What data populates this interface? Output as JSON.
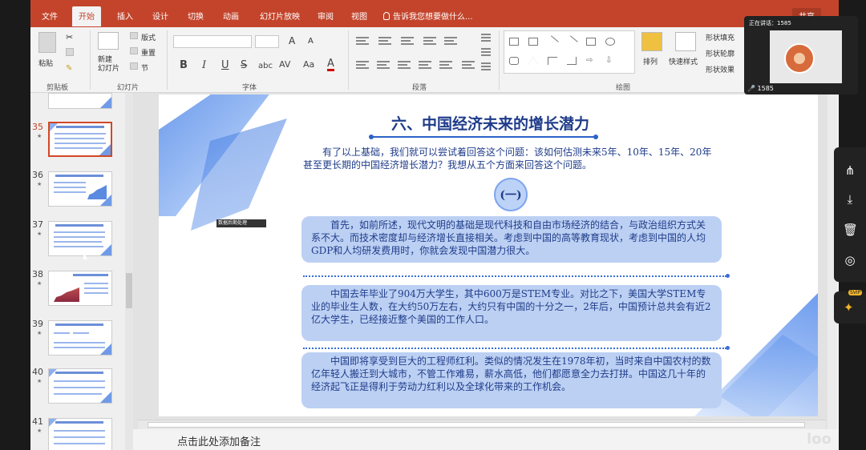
{
  "tabs": [
    "文件",
    "开始",
    "插入",
    "设计",
    "切换",
    "动画",
    "幻灯片放映",
    "审阅",
    "视图"
  ],
  "tell_me": "告诉我您想要做什么...",
  "share": "共享",
  "ribbon": {
    "clipboard": {
      "paste": "粘贴",
      "label": "剪贴板"
    },
    "slides": {
      "new_slide": "新建\n幻灯片",
      "layout": "版式",
      "reset": "重置",
      "section": "节",
      "label": "幻灯片"
    },
    "font": {
      "label": "字体",
      "bold": "B",
      "italic": "I",
      "underline": "U",
      "strike": "S",
      "spacing": "abc",
      "case": "AV",
      "size_up": "A",
      "size_down": "A",
      "change_case": "Aa",
      "font_color": "A"
    },
    "paragraph": {
      "label": "段落"
    },
    "drawing": {
      "arrange": "排列",
      "quick_styles": "快速样式",
      "shape_fill": "形状填充",
      "shape_outline": "形状轮廓",
      "shape_effects": "形状效果",
      "label": "绘图"
    }
  },
  "thumbnails": [
    {
      "num": "35",
      "active": true
    },
    {
      "num": "36",
      "active": false
    },
    {
      "num": "37",
      "active": false
    },
    {
      "num": "38",
      "active": false
    },
    {
      "num": "39",
      "active": false
    },
    {
      "num": "40",
      "active": false
    },
    {
      "num": "41",
      "active": false
    }
  ],
  "slide": {
    "title": "六、中国经济未来的增长潜力",
    "intro": "有了以上基础，我们就可以尝试着回答这个问题：该如何估测未来5年、10年、15年、20年甚至更长期的中国经济增长潜力？我想从五个方面来回答这个问题。",
    "circle": "(一)",
    "box1": "首先，如前所述，现代文明的基础是现代科技和自由市场经济的结合，与政治组织方式关系不大。而技术密度却与经济增长直接相关。考虑到中国的高等教育现状，考虑到中国的人均GDP和人均研发费用时，你就会发现中国潜力很大。",
    "box2": "中国去年毕业了904万大学生，其中600万是STEM专业。对比之下，美国大学STEM专业的毕业生人数，在大约50万左右，大约只有中国的十分之一，2年后，中国预计总共会有近2亿大学生，已经接近整个美国的工作人口。",
    "box3": "中国即将享受到巨大的工程师红利。类似的情况发生在1978年初，当时来自中国农村的数亿年轻人搬迁到大城市，不管工作难易，薪水高低，他们都愿意全力去打拼。中国这几十年的经济起飞正是得利于劳动力红利以及全球化带来的工作机会。",
    "media_chip": "数据后期处理"
  },
  "notes_placeholder": "点击此处添加备注",
  "video": {
    "status": "正在讲话：1585",
    "viewers": "1585"
  },
  "sidebar_icons": [
    "share-icon",
    "download-icon",
    "trash-icon",
    "target-icon"
  ],
  "pin_badge": "SVIP",
  "watermark": "loo"
}
